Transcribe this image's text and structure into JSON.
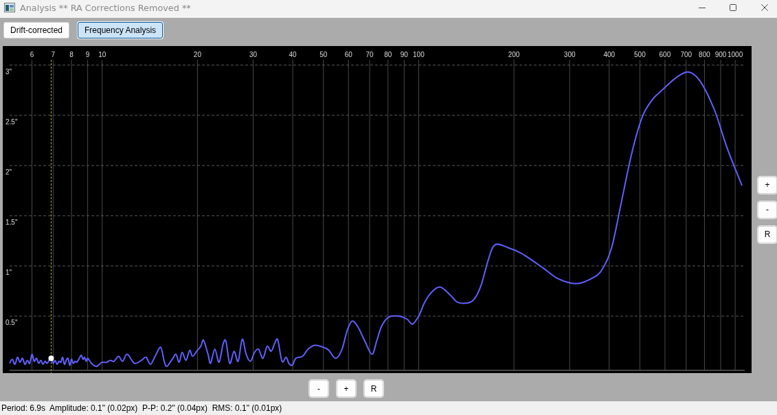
{
  "window": {
    "title": "Analysis ** RA Corrections Removed **"
  },
  "tabs": [
    {
      "label": "Drift-corrected",
      "selected": false
    },
    {
      "label": "Frequency Analysis",
      "selected": true
    }
  ],
  "chart": {
    "chart_data": {
      "type": "line",
      "log": "x",
      "grid": true,
      "x": [
        5.1,
        5.2,
        5.3,
        5.4,
        5.5,
        5.6,
        5.7,
        5.8,
        5.9,
        6.0,
        6.1,
        6.2,
        6.3,
        6.4,
        6.5,
        6.6,
        6.7,
        6.8,
        6.9,
        7.0,
        7.1,
        7.2,
        7.3,
        7.4,
        7.5,
        7.6,
        7.7,
        7.8,
        7.9,
        8.0,
        8.1,
        8.2,
        8.3,
        8.4,
        8.5,
        8.6,
        8.7,
        8.8,
        8.9,
        9.0,
        9.2,
        9.4,
        9.6,
        9.8,
        10,
        10.35,
        10.6,
        10.9,
        11.27,
        11.6,
        12.0,
        12.65,
        13.3,
        13.77,
        14.2,
        14.7,
        15.3,
        15.7,
        16.0,
        16.65,
        17.1,
        17.5,
        17.9,
        18.4,
        18.9,
        19.3,
        20,
        20.5,
        20.9,
        21.6,
        22.0,
        22.7,
        23.4,
        24.1,
        24.6,
        25.3,
        26.1,
        26.9,
        27.7,
        28.5,
        29.4,
        30.3,
        31.2,
        32.2,
        33.2,
        34.2,
        35.2,
        35.9,
        37.0,
        38.1,
        38.9,
        39.9,
        40.9,
        43.0,
        44.7,
        47.0,
        50.0,
        52.0,
        54.6,
        57.1,
        59.5,
        61.6,
        64.1,
        67.4,
        71.2,
        73.8,
        76.4,
        80.3,
        86.5,
        91.9,
        95.6,
        100,
        104.6,
        110,
        116.8,
        125.9,
        132.3,
        142.6,
        149.9,
        157.6,
        165.6,
        174.1,
        192.4,
        212.6,
        247,
        273,
        301.6,
        325,
        354,
        377.6,
        407,
        438.5,
        472.8,
        509.5,
        549,
        592,
        654,
        715.6,
        779,
        861,
        942,
        1051
      ],
      "series": [
        {
          "color": "#6060ff",
          "values": [
            0.03,
            0.07,
            0.02,
            0.09,
            0.04,
            0.08,
            0.02,
            0.06,
            0.03,
            0.12,
            0.05,
            0.08,
            0.03,
            0.06,
            0.02,
            0.05,
            0.03,
            0.06,
            0.08,
            0.03,
            0.06,
            0.02,
            0.05,
            0.04,
            0.09,
            0.02,
            0.06,
            0.08,
            0.01,
            0.07,
            0.03,
            0.05,
            0.04,
            0.06,
            0.09,
            0.11,
            0.07,
            0.09,
            0.05,
            0.08,
            0.04,
            0.01,
            0.0,
            0.02,
            0.04,
            0.04,
            0.06,
            0.05,
            0.1,
            0.05,
            0.12,
            0.03,
            0.06,
            0.09,
            0.02,
            0.1,
            0.19,
            0.05,
            0.0,
            0.07,
            0.12,
            0.04,
            0.14,
            0.06,
            0.16,
            0.1,
            0.16,
            0.2,
            0.26,
            0.12,
            0.03,
            0.17,
            0.04,
            0.22,
            0.25,
            0.03,
            0.15,
            0.05,
            0.27,
            0.12,
            0.05,
            0.14,
            0.17,
            0.08,
            0.2,
            0.15,
            0.24,
            0.26,
            0.05,
            0.09,
            0.03,
            0.01,
            0.08,
            0.1,
            0.17,
            0.21,
            0.19,
            0.16,
            0.08,
            0.16,
            0.36,
            0.45,
            0.4,
            0.26,
            0.12,
            0.26,
            0.4,
            0.49,
            0.5,
            0.47,
            0.42,
            0.5,
            0.64,
            0.74,
            0.79,
            0.71,
            0.64,
            0.63,
            0.67,
            0.81,
            1.05,
            1.21,
            1.18,
            1.12,
            0.98,
            0.88,
            0.83,
            0.83,
            0.88,
            0.95,
            1.18,
            1.66,
            2.14,
            2.49,
            2.66,
            2.76,
            2.88,
            2.93,
            2.83,
            2.55,
            2.18,
            1.8
          ]
        }
      ],
      "xlim": [
        5.1,
        1072
      ],
      "ylim": [
        -0.04,
        3.19
      ],
      "xticks": [
        6,
        7,
        8,
        9,
        10,
        20,
        30,
        40,
        50,
        60,
        70,
        80,
        90,
        100,
        200,
        300,
        400,
        500,
        600,
        700,
        800,
        900,
        1000
      ],
      "yticks": [
        {
          "value": 0.5,
          "label": "0.5\""
        },
        {
          "value": 1,
          "label": "1\""
        },
        {
          "value": 1.5,
          "label": "1.5\""
        },
        {
          "value": 2,
          "label": "2\""
        },
        {
          "value": 2.5,
          "label": "2.5\""
        },
        {
          "value": 3,
          "label": "3\""
        }
      ],
      "ref_lines": [
        {
          "axis": "x",
          "value": 6.9
        }
      ]
    }
  },
  "y_zoom_buttons": [
    "+",
    "-",
    "R"
  ],
  "x_zoom_buttons": [
    "-",
    "+",
    "R"
  ],
  "status_bar": {
    "text": "Period: 6.9s  Amplitude: 0.1\" (0.02px)  P-P: 0.2\" (0.04px)  RMS: 0.1\" (0.01px)"
  }
}
